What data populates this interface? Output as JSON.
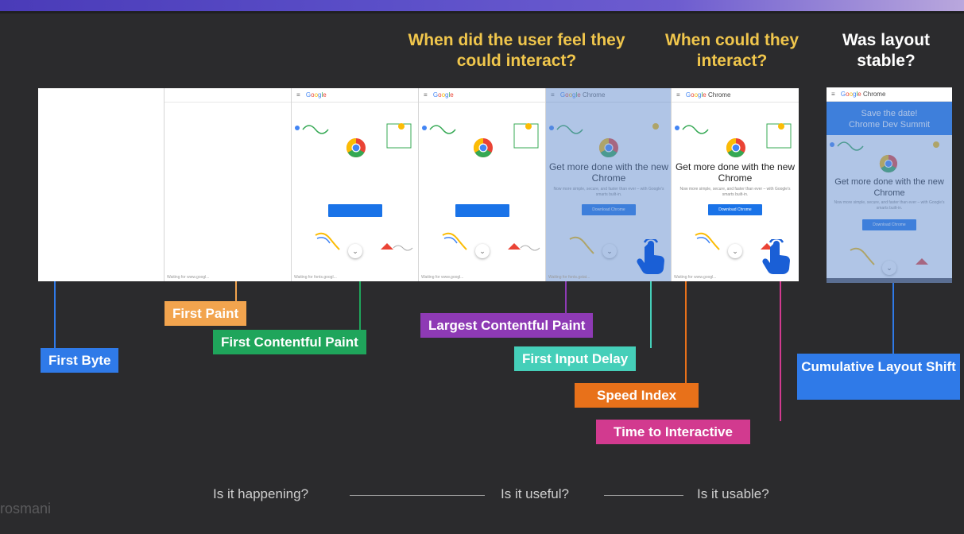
{
  "questions": {
    "feel_interact": "When did the user feel they could interact?",
    "could_interact": "When could they interact?",
    "layout_stable": "Was layout stable?"
  },
  "frames": {
    "google_brand": [
      "G",
      "o",
      "o",
      "g",
      "l",
      "e"
    ],
    "google_chrome_suffix": "Chrome",
    "footer_wait_page": "Waiting for www.googl...",
    "footer_wait_fonts": "Waiting for fonts.googl...",
    "footer_wait_fonts_short": "Waiting for fonts.gstat...",
    "footer_wait_page2": "Waiting for www.googl...",
    "headline": "Get more done with the new Chrome",
    "subline": "Now more simple, secure, and faster than ever – with Google's smarts built-in.",
    "download_button": "Download Chrome",
    "banner_line1": "Save the date!",
    "banner_line2": "Chrome Dev Summit"
  },
  "metrics": {
    "first_byte": "First Byte",
    "first_paint": "First Paint",
    "fcp": "First Contentful Paint",
    "lcp": "Largest Contentful Paint",
    "fid": "First Input Delay",
    "speed_index": "Speed Index",
    "tti": "Time to Interactive",
    "cls": "Cumulative Layout Shift"
  },
  "colors": {
    "first_byte": "#2f7ae8",
    "first_paint": "#f2a44e",
    "fcp": "#1fa55b",
    "lcp": "#8e3ab5",
    "fid": "#45cfb9",
    "speed_index": "#e8711a",
    "tti": "#d23a8f",
    "cls": "#2f7ae8",
    "question_yellow": "#f0c64c"
  },
  "bottom": {
    "happening": "Is it happening?",
    "useful": "Is it useful?",
    "usable": "Is it usable?"
  },
  "watermark": "rosmani"
}
